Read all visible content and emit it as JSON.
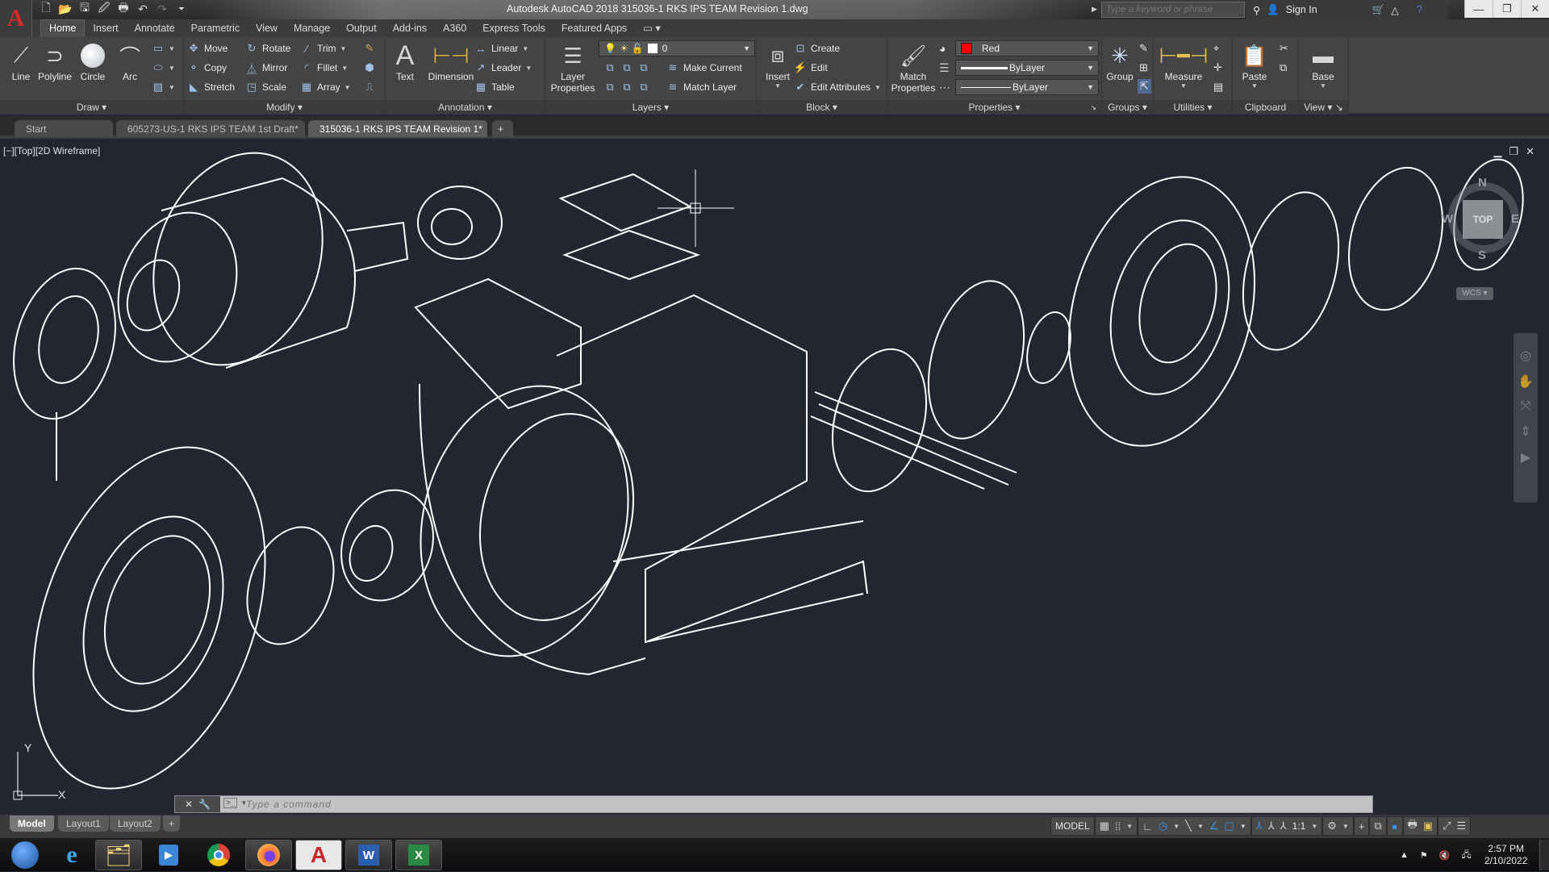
{
  "window": {
    "title": "Autodesk AutoCAD 2018    315036-1 RKS IPS TEAM Revision 1.dwg",
    "search_placeholder": "Type a keyword or phrase",
    "sign_in": "Sign In"
  },
  "ribbon_tabs": [
    "Home",
    "Insert",
    "Annotate",
    "Parametric",
    "View",
    "Manage",
    "Output",
    "Add-ins",
    "A360",
    "Express Tools",
    "Featured Apps"
  ],
  "active_ribbon_tab": "Home",
  "ribbon": {
    "draw": {
      "title": "Draw",
      "line": "Line",
      "polyline": "Polyline",
      "circle": "Circle",
      "arc": "Arc"
    },
    "modify": {
      "title": "Modify",
      "move": "Move",
      "rotate": "Rotate",
      "trim": "Trim",
      "copy": "Copy",
      "mirror": "Mirror",
      "fillet": "Fillet",
      "stretch": "Stretch",
      "scale": "Scale",
      "array": "Array"
    },
    "annotation": {
      "title": "Annotation",
      "text": "Text",
      "dimension": "Dimension",
      "linear": "Linear",
      "leader": "Leader",
      "table": "Table"
    },
    "layers": {
      "title": "Layers",
      "layer_properties": "Layer Properties",
      "current_layer": "0",
      "make_current": "Make Current",
      "match_layer": "Match Layer"
    },
    "block": {
      "title": "Block",
      "insert": "Insert",
      "create": "Create",
      "edit": "Edit",
      "edit_attributes": "Edit Attributes"
    },
    "properties": {
      "title": "Properties",
      "match_properties": "Match Properties",
      "color": "Red",
      "color_hex": "#ff0000",
      "linetype": "ByLayer",
      "lineweight": "ByLayer"
    },
    "groups": {
      "title": "Groups",
      "group": "Group"
    },
    "utilities": {
      "title": "Utilities",
      "measure": "Measure"
    },
    "clipboard": {
      "title": "Clipboard",
      "paste": "Paste"
    },
    "view": {
      "title": "View",
      "base": "Base"
    }
  },
  "doc_tabs": [
    {
      "label": "Start"
    },
    {
      "label": "605273-US-1 RKS IPS TEAM 1st Draft*"
    },
    {
      "label": "315036-1 RKS IPS TEAM Revision 1*"
    }
  ],
  "viewport": {
    "label": "[−][Top][2D Wireframe]",
    "viewcube": {
      "face": "TOP",
      "north": "N",
      "south": "S",
      "east": "E",
      "west": "W",
      "ucs": "WCS"
    },
    "ucs_x": "X",
    "ucs_y": "Y"
  },
  "command": {
    "placeholder": "Type a command"
  },
  "layout_tabs": [
    "Model",
    "Layout1",
    "Layout2"
  ],
  "status": {
    "space": "MODEL",
    "scale": "1:1"
  },
  "taskbar": {
    "apps": [
      "start",
      "internet-explorer",
      "file-explorer",
      "media-player",
      "chrome",
      "firefox",
      "autocad",
      "word",
      "excel"
    ],
    "time": "2:57 PM",
    "date": "2/10/2022"
  }
}
